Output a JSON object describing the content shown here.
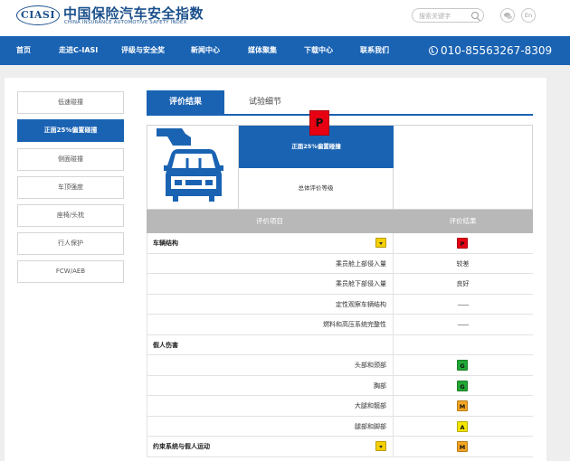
{
  "header": {
    "logo_mark": "CIASI",
    "logo_cn": "中国保险汽车安全指数",
    "logo_en": "CHINA INSURANCE AUTOMOTIVE SAFETY INDEX",
    "search_placeholder": "搜索关键字",
    "lang_label": "En"
  },
  "nav": {
    "items": [
      {
        "label": "首页"
      },
      {
        "label": "走进C-IASI"
      },
      {
        "label": "评级与安全奖"
      },
      {
        "label": "新闻中心"
      },
      {
        "label": "媒体聚集"
      },
      {
        "label": "下载中心"
      },
      {
        "label": "联系我们"
      }
    ],
    "phone": "010-85563267-8309"
  },
  "sidebar": {
    "items": [
      {
        "label": "低速碰撞"
      },
      {
        "label": "正面25%偏置碰撞"
      },
      {
        "label": "侧面碰撞"
      },
      {
        "label": "车顶强度"
      },
      {
        "label": "座椅/头枕"
      },
      {
        "label": "行人保护"
      },
      {
        "label": "FCW/AEB"
      }
    ],
    "active_index": 1
  },
  "tabs": [
    {
      "label": "评价结果"
    },
    {
      "label": "试验细节"
    }
  ],
  "summary": {
    "test_name": "正面25%偏置碰撞",
    "overall_label": "总体评价等级",
    "overall_rating": "P",
    "overall_color": "#e60012"
  },
  "table": {
    "headers": {
      "item": "评价项目",
      "result": "评价结果"
    },
    "rows": [
      {
        "type": "category",
        "label": "车辆结构",
        "badge": "P",
        "color": "#e60012"
      },
      {
        "type": "item",
        "label": "乘员舱上部侵入量",
        "result": "较差"
      },
      {
        "type": "item",
        "label": "乘员舱下部侵入量",
        "result": "良好"
      },
      {
        "type": "item",
        "label": "定性观察车辆结构",
        "result": "——"
      },
      {
        "type": "item",
        "label": "燃料和高压系统完整性",
        "result": "——"
      },
      {
        "type": "category",
        "label": "假人伤害"
      },
      {
        "type": "item",
        "label": "头部和颈部",
        "badge": "G",
        "color": "#22a836"
      },
      {
        "type": "item",
        "label": "胸部",
        "badge": "G",
        "color": "#22a836"
      },
      {
        "type": "item",
        "label": "大腿和髋部",
        "badge": "M",
        "color": "#f5a623"
      },
      {
        "type": "item",
        "label": "腿部和脚部",
        "badge": "A",
        "color": "#f5e600"
      },
      {
        "type": "category",
        "label": "约束系统与假人运动",
        "badge": "M",
        "color": "#f5a623"
      }
    ]
  }
}
